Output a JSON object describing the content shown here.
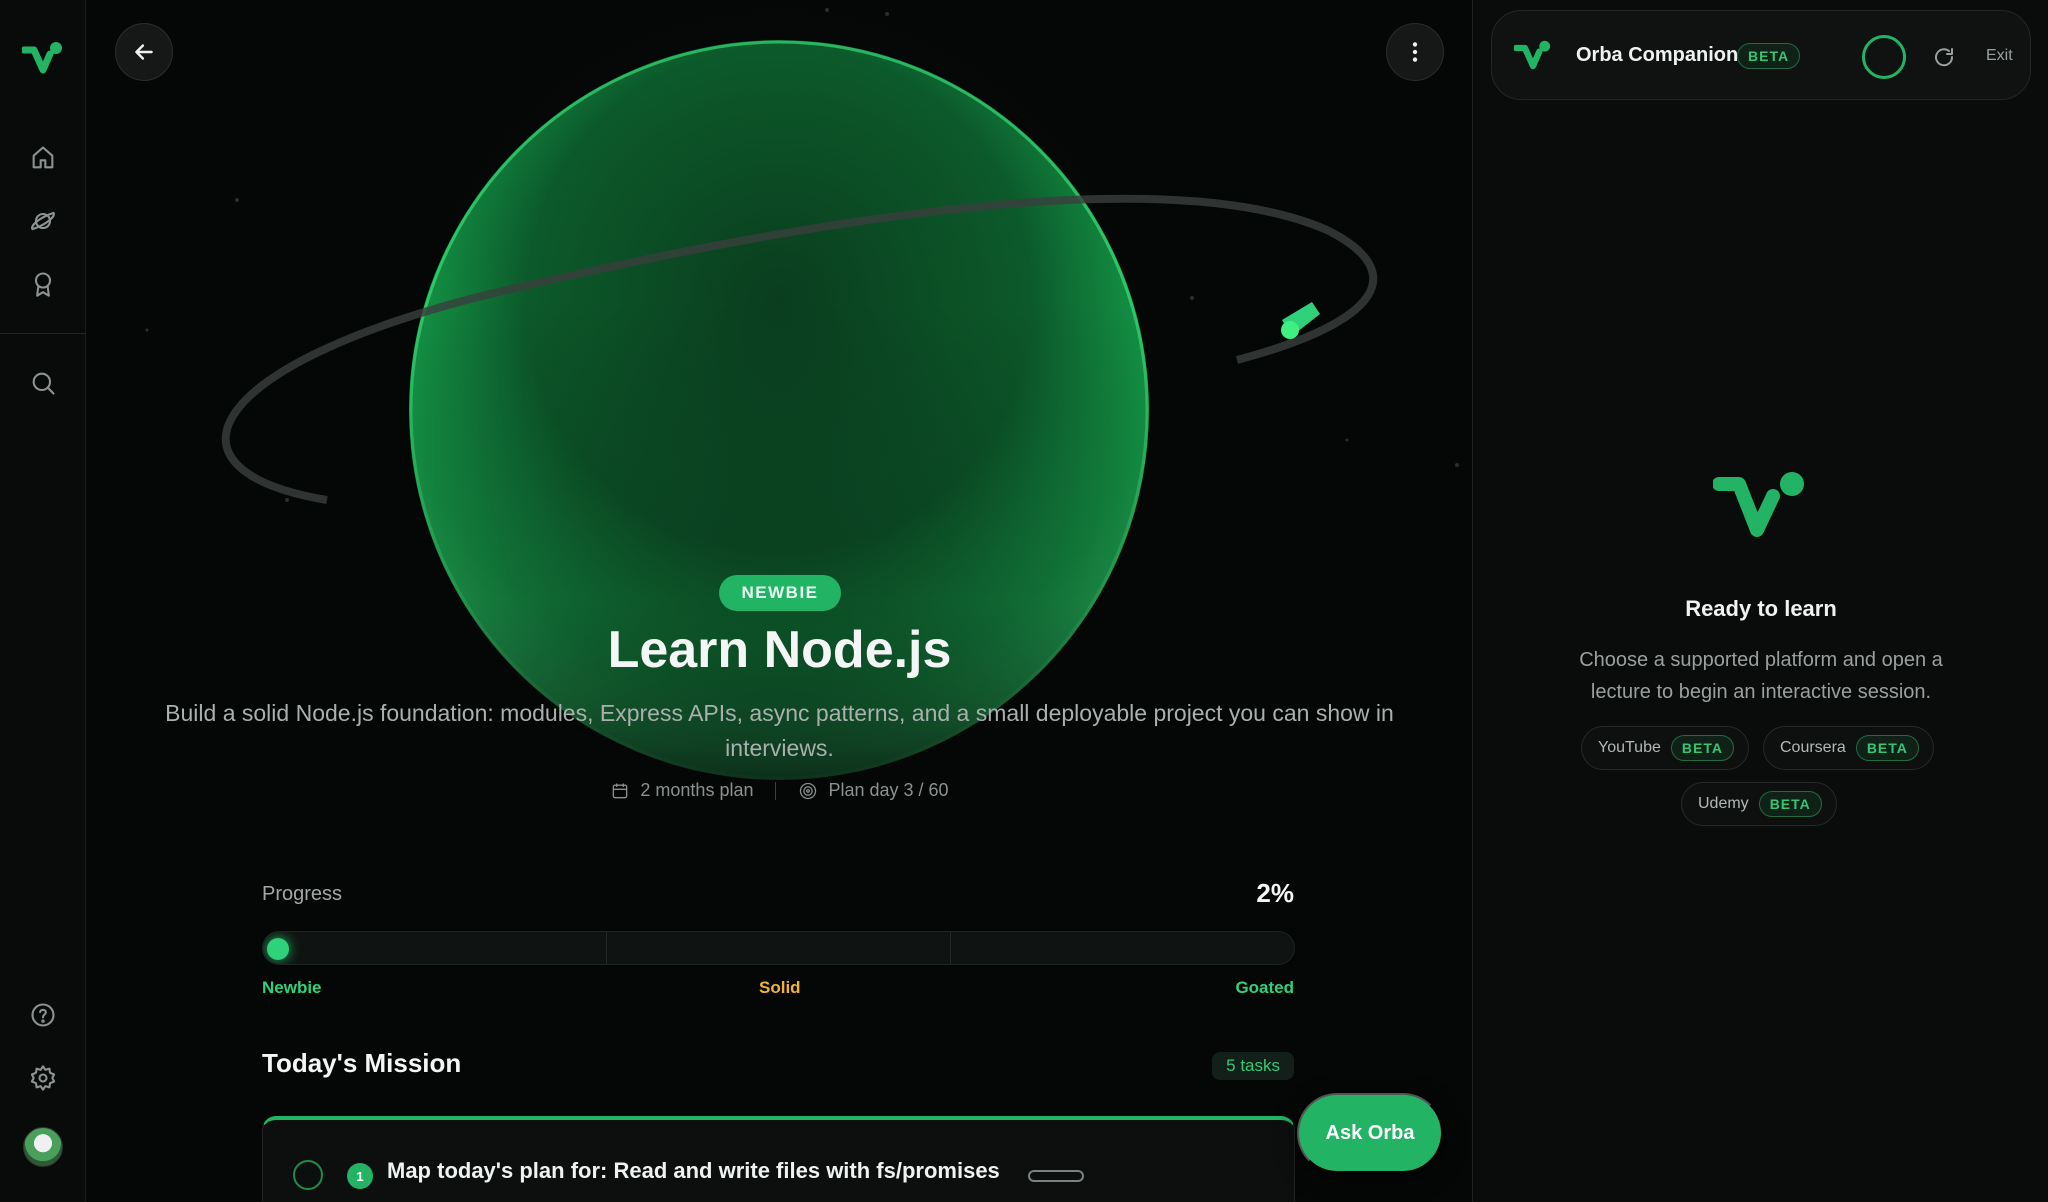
{
  "rail": {
    "items": [
      {
        "name": "home-icon"
      },
      {
        "name": "planet-icon"
      },
      {
        "name": "award-icon"
      },
      {
        "name": "search-icon"
      },
      {
        "name": "help-icon"
      },
      {
        "name": "settings-icon"
      }
    ]
  },
  "course": {
    "level_badge": "NEWBIE",
    "title": "Learn Node.js",
    "description": "Build a solid Node.js foundation: modules, Express APIs, async patterns, and a small deployable project you can show in interviews.",
    "plan_length": "2 months plan",
    "plan_day": "Plan day 3 / 60"
  },
  "progress": {
    "label": "Progress",
    "percent_text": "2%",
    "value": 0.02,
    "levels": [
      {
        "label": "Newbie",
        "color": "#2fd27a"
      },
      {
        "label": "Solid",
        "color": "#f2b233"
      },
      {
        "label": "Goated",
        "color": "#2fd27a"
      }
    ]
  },
  "mission": {
    "title": "Today's Mission",
    "tasks_count": "5 tasks",
    "first_task": {
      "number": "1",
      "text": "Map today's plan for: Read and write files with fs/promises"
    }
  },
  "ask_button": "Ask Orba",
  "companion": {
    "title": "Orba Companion",
    "beta": "BETA",
    "exit": "Exit",
    "empty_title": "Ready to learn",
    "empty_desc": "Choose a supported platform and open a lecture to begin an interactive session.",
    "platforms": [
      {
        "name": "YouTube",
        "badge": "BETA"
      },
      {
        "name": "Coursera",
        "badge": "BETA"
      },
      {
        "name": "Udemy",
        "badge": "BETA"
      }
    ]
  },
  "colors": {
    "accent": "#22b464",
    "background": "#050606",
    "solid_level": "#f2b233"
  }
}
